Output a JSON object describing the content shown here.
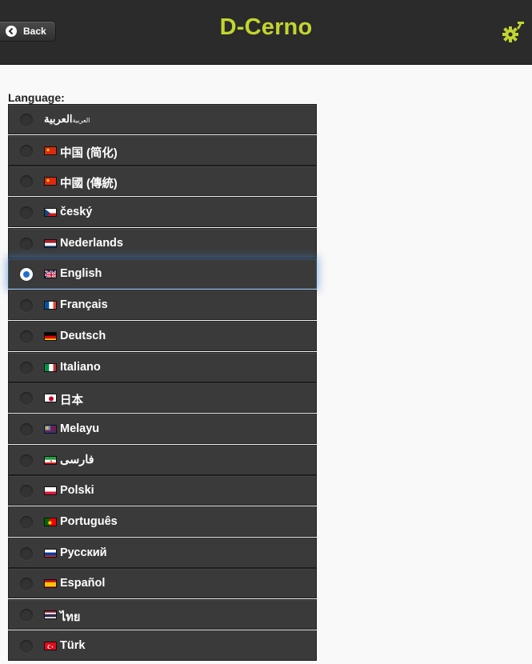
{
  "header": {
    "back_label": "Back",
    "title": "D-Cerno",
    "title_color": "#c3d52e",
    "settings_icon": "gear-icon"
  },
  "language_label": "Language:",
  "languages": [
    {
      "label": "العربية",
      "suffix": "العربية",
      "flag": "none",
      "selected": false
    },
    {
      "label": "中国 (简化)",
      "flag": "cn",
      "selected": false
    },
    {
      "label": "中國 (傳統)",
      "flag": "cn",
      "selected": false
    },
    {
      "label": "český",
      "flag": "cz",
      "selected": false
    },
    {
      "label": "Nederlands",
      "flag": "nl",
      "selected": false
    },
    {
      "label": "English",
      "flag": "uk",
      "selected": true
    },
    {
      "label": "Français",
      "flag": "fr",
      "selected": false
    },
    {
      "label": "Deutsch",
      "flag": "de",
      "selected": false
    },
    {
      "label": "Italiano",
      "flag": "it",
      "selected": false
    },
    {
      "label": "日本",
      "flag": "jp",
      "selected": false
    },
    {
      "label": "Melayu",
      "flag": "my",
      "selected": false
    },
    {
      "label": "فارسی",
      "flag": "ir",
      "selected": false
    },
    {
      "label": "Polski",
      "flag": "pl",
      "selected": false
    },
    {
      "label": "Português",
      "flag": "pt",
      "selected": false
    },
    {
      "label": "Русский",
      "flag": "ru",
      "selected": false
    },
    {
      "label": "Español",
      "flag": "es",
      "selected": false
    },
    {
      "label": "ไทย",
      "flag": "th",
      "selected": false
    },
    {
      "label": "Türk",
      "flag": "tr",
      "selected": false
    }
  ]
}
